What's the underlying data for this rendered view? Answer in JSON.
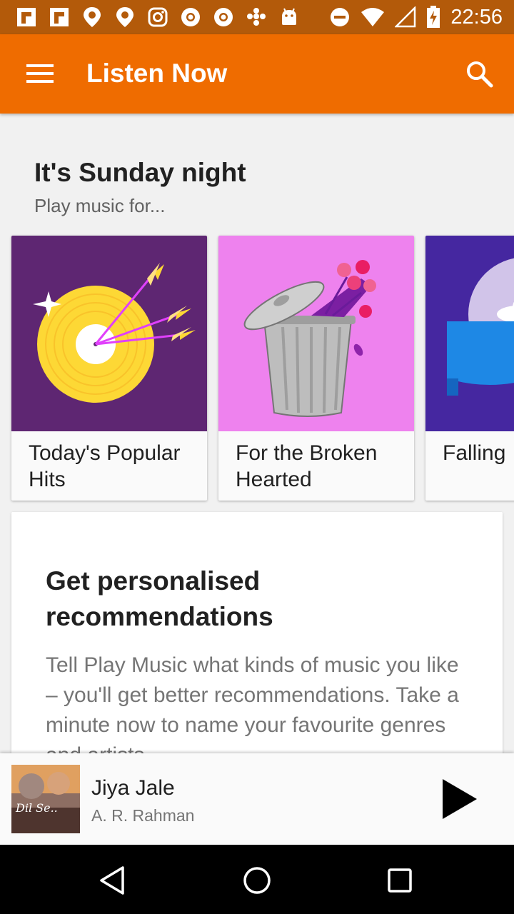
{
  "status_bar": {
    "time": "22:56",
    "icons": [
      "flipboard-icon",
      "flipboard-icon",
      "maps-pin-icon",
      "maps-pin-icon",
      "instagram-icon",
      "chrome-icon",
      "chrome-icon",
      "dialpad-icon",
      "android-icon",
      "do-not-disturb-icon",
      "wifi-icon",
      "signal-icon",
      "battery-charging-icon"
    ]
  },
  "app_bar": {
    "title": "Listen Now",
    "menu_icon": "menu-icon",
    "search_icon": "search-icon",
    "color": "#ef6c00"
  },
  "section": {
    "title": "It's Sunday night",
    "subtitle": "Play music for..."
  },
  "cards": [
    {
      "label": "Today's Popular Hits",
      "color": "#5e2672"
    },
    {
      "label": "For the Broken Hearted",
      "color": "#ee82ee"
    },
    {
      "label": "Falling",
      "color": "#4527a0"
    }
  ],
  "recommendation": {
    "title": "Get personalised recommendations",
    "body": "Tell Play Music what kinds of music you like – you'll get better recommendations. Take a minute now to name your favourite genres and artists."
  },
  "now_playing": {
    "title": "Jiya Jale",
    "artist": "A. R. Rahman",
    "album_text": "Dil Se..",
    "play_icon": "play-icon"
  },
  "nav_bar": {
    "back_icon": "back-icon",
    "home_icon": "home-icon",
    "recents_icon": "recents-icon"
  }
}
